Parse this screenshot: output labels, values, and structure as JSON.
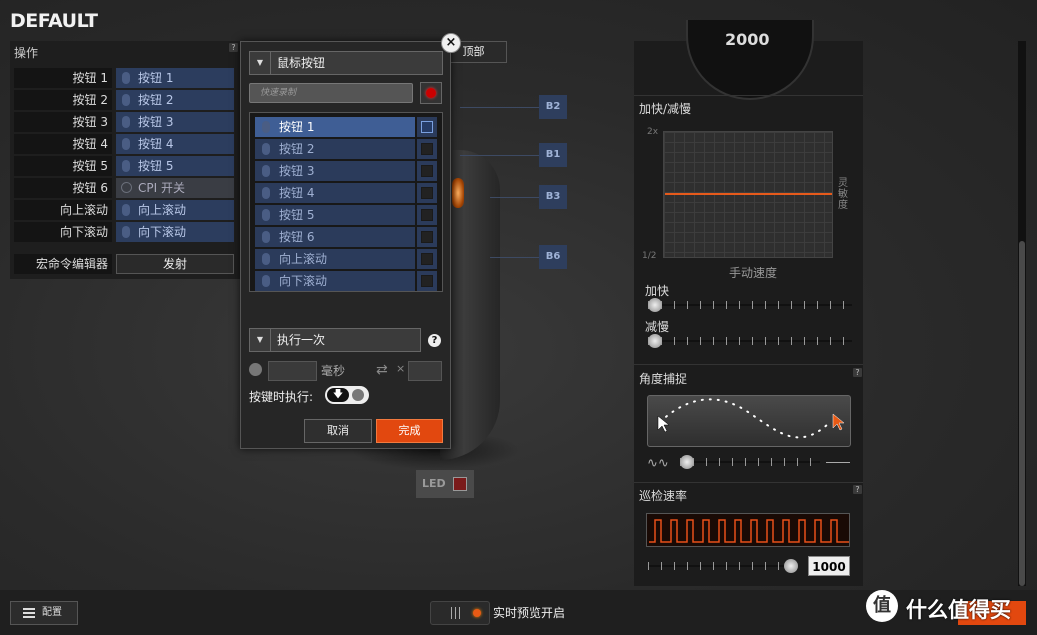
{
  "window": {
    "title": "DEFAULT",
    "top_button": "顶部"
  },
  "actions": {
    "heading": "操作",
    "help": "?",
    "rows": [
      {
        "name": "按钮 1",
        "value": "按钮 1"
      },
      {
        "name": "按钮 2",
        "value": "按钮 2"
      },
      {
        "name": "按钮 3",
        "value": "按钮 3"
      },
      {
        "name": "按钮 4",
        "value": "按钮 4"
      },
      {
        "name": "按钮 5",
        "value": "按钮 5"
      },
      {
        "name": "按钮 6",
        "value": "CPI 开关"
      },
      {
        "name": "向上滚动",
        "value": "向上滚动"
      },
      {
        "name": "向下滚动",
        "value": "向下滚动"
      }
    ],
    "macro_label": "宏命令编辑器",
    "fire_button": "发射"
  },
  "mouse_callouts": [
    "B2",
    "B1",
    "B3",
    "B6"
  ],
  "led": {
    "label": "LED",
    "color": "#7a1a1a"
  },
  "popup": {
    "close": "×",
    "category_dropdown": "鼠标按钮",
    "record_placeholder": "快速录制",
    "list": [
      {
        "label": "按钮 1",
        "selected": true
      },
      {
        "label": "按钮 2",
        "selected": false
      },
      {
        "label": "按钮 3",
        "selected": false
      },
      {
        "label": "按钮 4",
        "selected": false
      },
      {
        "label": "按钮 5",
        "selected": false
      },
      {
        "label": "按钮 6",
        "selected": false
      },
      {
        "label": "向上滚动",
        "selected": false
      },
      {
        "label": "向下滚动",
        "selected": false
      }
    ],
    "exec_dropdown": "执行一次",
    "exec_help": "?",
    "delay_unit": "毫秒",
    "repeat_times_symbol": "×",
    "on_press_label": "按键时执行:",
    "cancel": "取消",
    "done": "完成"
  },
  "right": {
    "dial_value": "2000",
    "accel_title": "加快/减慢",
    "graph_top": "2x",
    "graph_bottom": "1/2",
    "graph_side": "灵敏度",
    "graph_x": "手动速度",
    "accel_label": "加快",
    "decel_label": "减慢",
    "angle_title": "角度捕捉",
    "poll_title": "巡检速率",
    "poll_value": "1000",
    "help": "?"
  },
  "bottom": {
    "config_button": "配置",
    "preview_label": "实时预览开启",
    "watermark_logo": "值",
    "watermark_text": "什么值得买"
  },
  "colors": {
    "accent": "#e2480f",
    "selection": "#3f5e95",
    "list_item": "#2b3b5b"
  }
}
